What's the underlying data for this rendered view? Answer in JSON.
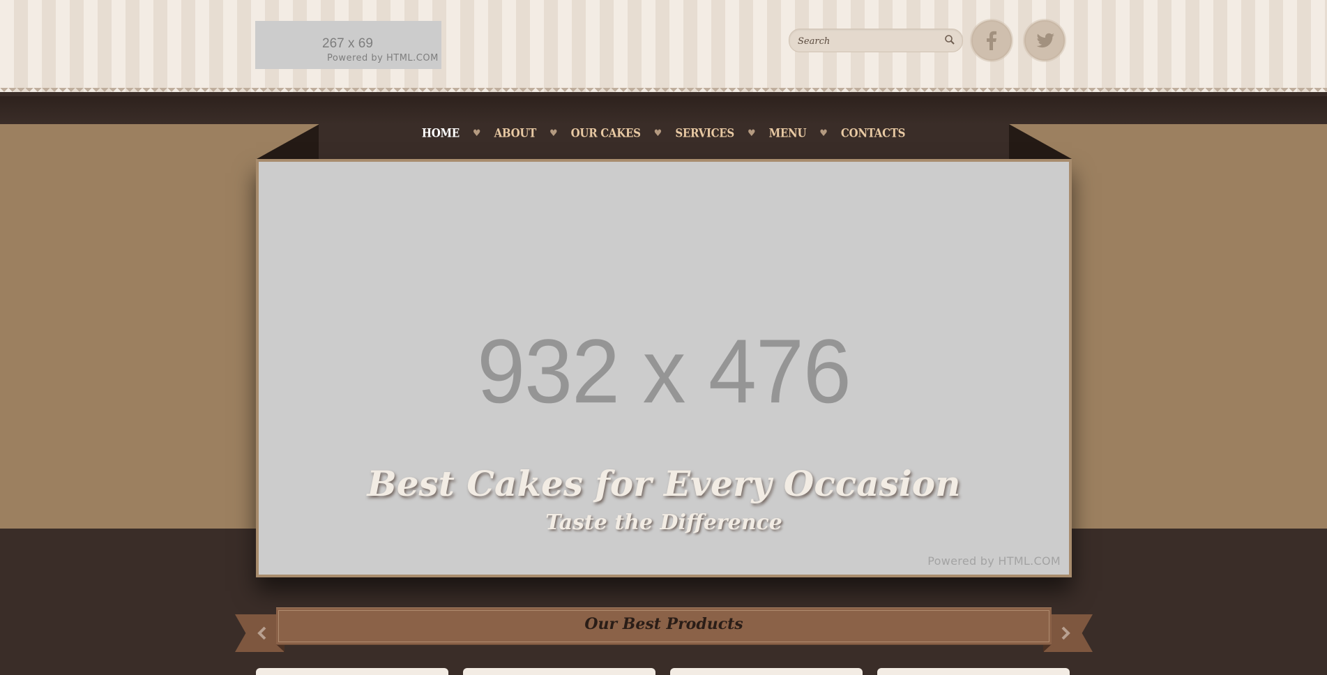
{
  "header": {
    "logo": {
      "dims": "267 x 69",
      "powered": "Powered by HTML.COM"
    },
    "search": {
      "placeholder": "Search"
    },
    "social": [
      "facebook-icon",
      "twitter-icon"
    ]
  },
  "nav": {
    "items": [
      {
        "label": "HOME",
        "active": true
      },
      {
        "label": "ABOUT",
        "active": false
      },
      {
        "label": "OUR CAKES",
        "active": false
      },
      {
        "label": "SERVICES",
        "active": false
      },
      {
        "label": "MENU",
        "active": false
      },
      {
        "label": "CONTACTS",
        "active": false
      }
    ],
    "separator": "♥"
  },
  "slider": {
    "dims": "932 x 476",
    "title": "Best Cakes for Every Occasion",
    "subtitle": "Taste the Difference",
    "powered": "Powered by HTML.COM"
  },
  "products": {
    "title": "Our Best Products",
    "prev": "‹",
    "next": "›"
  },
  "colors": {
    "stripe_light": "#f3ece4",
    "stripe_dark": "#e7ddd2",
    "dark_brown": "#3a2d28",
    "tan": "#9c8060",
    "ribbon": "#8b6248",
    "nav_text": "#e8c9a3"
  }
}
